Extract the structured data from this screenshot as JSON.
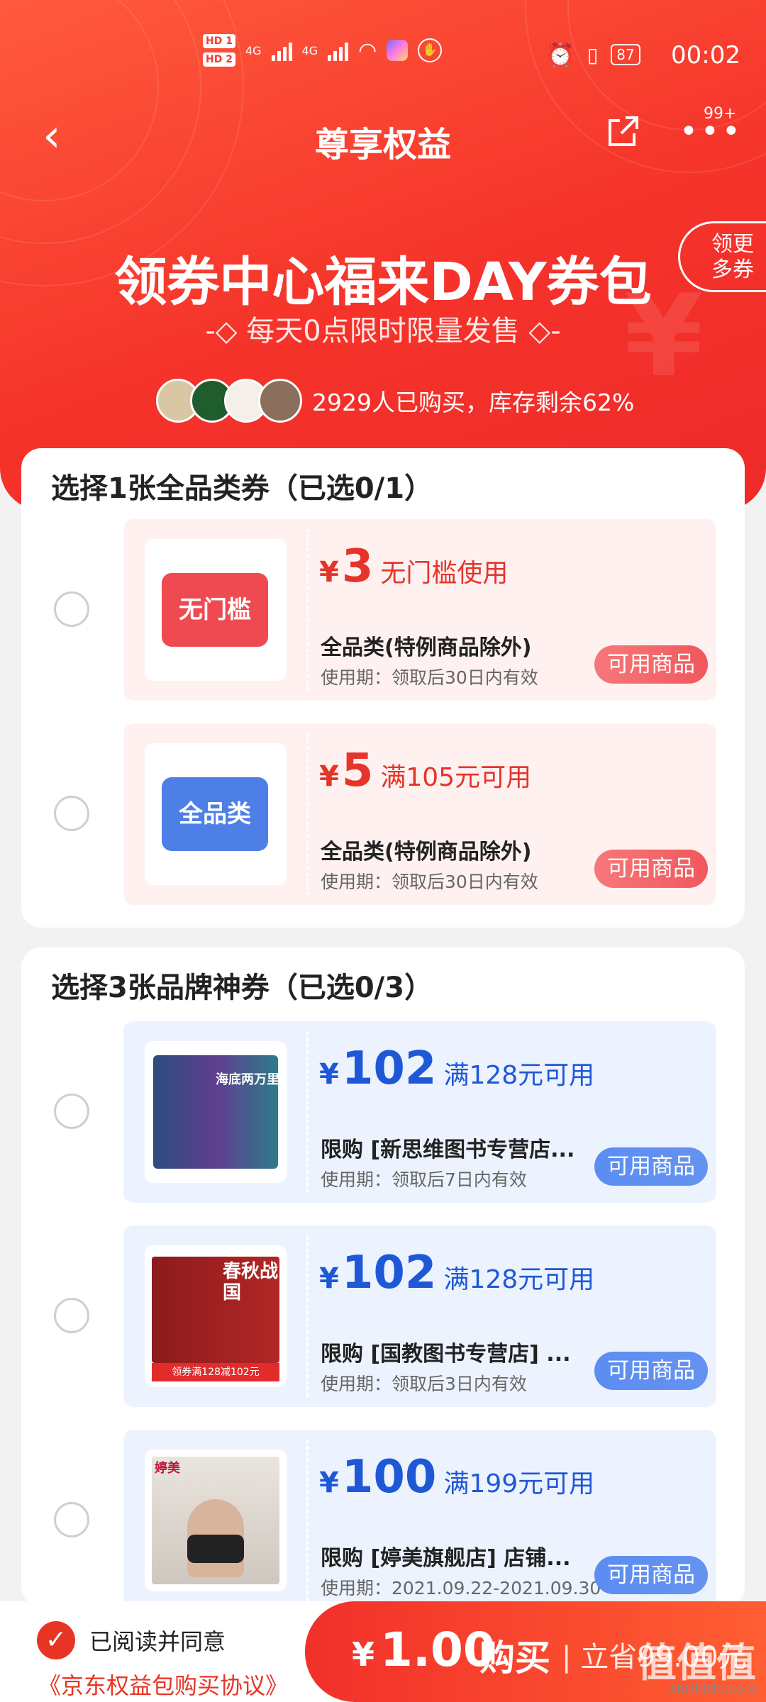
{
  "status": {
    "time": "00:02",
    "battery": "87",
    "sim1": "HD 1",
    "sim2": "HD 2",
    "net1": "4G",
    "net2": "4G"
  },
  "nav": {
    "title": "尊享权益",
    "badge": "99+"
  },
  "hero": {
    "title": "领券中心福来DAY券包",
    "subtitle": "-◇ 每天0点限时限量发售 ◇-",
    "buyers": "2929人已购买，库存剩余62%",
    "more_coupons_line1": "领更",
    "more_coupons_line2": "多券"
  },
  "section1": {
    "title": "选择1张全品类券（已选0/1）",
    "coupons": [
      {
        "tag": "无门槛",
        "amount": "3",
        "yen": "¥",
        "condition": "无门槛使用",
        "scope": "全品类(特例商品除外)",
        "validity": "使用期：领取后30日内有效",
        "button": "可用商品"
      },
      {
        "tag": "全品类",
        "amount": "5",
        "yen": "¥",
        "condition": "满105元可用",
        "scope": "全品类(特例商品除外)",
        "validity": "使用期：领取后30日内有效",
        "button": "可用商品"
      }
    ]
  },
  "section2": {
    "title": "选择3张品牌神券（已选0/3）",
    "coupons": [
      {
        "img_text": "海底两万里",
        "amount": "102",
        "yen": "¥",
        "condition": "满128元可用",
        "scope": "限购 [新思维图书专营店...",
        "validity": "使用期：领取后7日内有效",
        "button": "可用商品"
      },
      {
        "img_text": "春秋战国",
        "img_badge": "领券满128减102元",
        "amount": "102",
        "yen": "¥",
        "condition": "满128元可用",
        "scope": "限购 [国教图书专营店] ...",
        "validity": "使用期：领取后3日内有效",
        "button": "可用商品"
      },
      {
        "img_text": "婷美",
        "amount": "100",
        "yen": "¥",
        "condition": "满199元可用",
        "scope": "限购 [婷美旗舰店] 店铺...",
        "validity": "使用期：2021.09.22-2021.09.30",
        "button": "可用商品"
      }
    ]
  },
  "footer": {
    "agree": "已阅读并同意",
    "agreement": "《京东权益包购买协议》",
    "yen": "¥",
    "price": "1.00",
    "buy": "购买",
    "save": "| 立省99.00元"
  },
  "watermark": {
    "logo": "值值值",
    "site": "zhizhizhi.com"
  }
}
